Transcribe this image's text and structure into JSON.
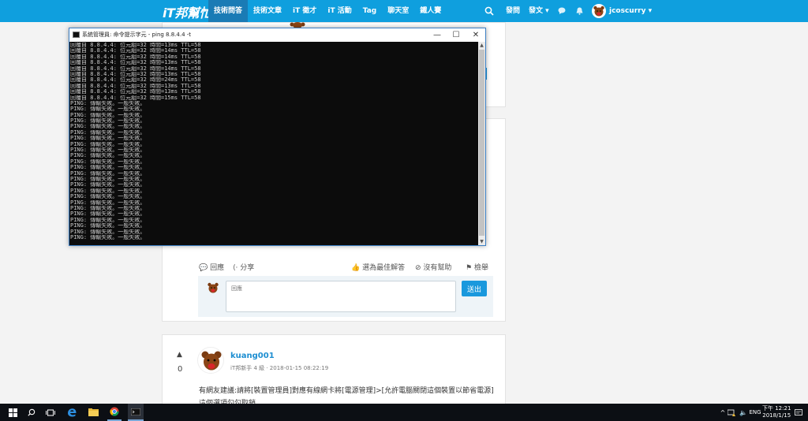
{
  "colors": {
    "brand": "#0f9fde",
    "nav_active": "#1a7bb5",
    "link": "#1d8ed1",
    "console_bg": "#0c0c0c",
    "taskbar": "#0c0f14"
  },
  "header": {
    "logo": "iT邦幫忙",
    "nav": [
      {
        "label": "技術問答",
        "active": true
      },
      {
        "label": "技術文章",
        "active": false
      },
      {
        "label": "iT 徵才",
        "active": false
      },
      {
        "label": "iT 活動",
        "active": false
      },
      {
        "label": "Tag",
        "active": false
      },
      {
        "label": "聊天室",
        "active": false
      },
      {
        "label": "鐵人賽",
        "active": false
      }
    ],
    "ask": "發問",
    "post": "發文",
    "username": "jcoscurry",
    "icons": [
      "search-icon",
      "chat-icon",
      "bell-icon",
      "caret-down-icon"
    ]
  },
  "console": {
    "title": "系統管理員: 命令提示字元 - ping  8.8.4.4 -t",
    "minimize": "—",
    "maximize": "☐",
    "close": "✕",
    "lines": [
      "回覆自 8.8.4.4: 位元組=32 時間=13ms TTL=58",
      "回覆自 8.8.4.4: 位元組=32 時間=14ms TTL=58",
      "回覆自 8.8.4.4: 位元組=32 時間=14ms TTL=58",
      "回覆自 8.8.4.4: 位元組=32 時間=13ms TTL=58",
      "回覆自 8.8.4.4: 位元組=32 時間=14ms TTL=58",
      "回覆自 8.8.4.4: 位元組=32 時間=13ms TTL=58",
      "回覆自 8.8.4.4: 位元組=32 時間=24ms TTL=58",
      "回覆自 8.8.4.4: 位元組=32 時間=13ms TTL=58",
      "回覆自 8.8.4.4: 位元組=32 時間=13ms TTL=58",
      "回覆自 8.8.4.4: 位元組=32 時間=15ms TTL=58",
      "PING: 傳輸失敗。一般失敗。",
      "PING: 傳輸失敗。一般失敗。",
      "PING: 傳輸失敗。一般失敗。",
      "PING: 傳輸失敗。一般失敗。",
      "PING: 傳輸失敗。一般失敗。",
      "PING: 傳輸失敗。一般失敗。",
      "PING: 傳輸失敗。一般失敗。",
      "PING: 傳輸失敗。一般失敗。",
      "PING: 傳輸失敗。一般失敗。",
      "PING: 傳輸失敗。一般失敗。",
      "PING: 傳輸失敗。一般失敗。",
      "PING: 傳輸失敗。一般失敗。",
      "PING: 傳輸失敗。一般失敗。",
      "PING: 傳輸失敗。一般失敗。",
      "PING: 傳輸失敗。一般失敗。",
      "PING: 傳輸失敗。一般失敗。",
      "PING: 傳輸失敗。一般失敗。",
      "PING: 傳輸失敗。一般失敗。",
      "PING: 傳輸失敗。一般失敗。",
      "PING: 傳輸失敗。一般失敗。",
      "PING: 傳輸失敗。一般失敗。",
      "PING: 傳輸失敗。一般失敗。",
      "PING: 傳輸失敗。一般失敗。",
      "PING: 傳輸失敗。一般失敗。"
    ]
  },
  "actions": {
    "reply": "回應",
    "share": "分享",
    "best_answer": "選為最佳解答",
    "not_helpful": "沒有幫助",
    "report": "檢舉"
  },
  "reply_form": {
    "placeholder": "回應",
    "submit": "送出"
  },
  "answer": {
    "votes": "0",
    "author": "kuang001",
    "meta": "iT邦新手 4 級 · 2018-01-15 08:22:19",
    "text": "有網友建議:請將[裝置管理員]對應有線網卡將[電源管理]>[允許電腦關閉這個裝置以節省電源]這個選項勾勾取銷."
  },
  "taskbar": {
    "lang": "ENG",
    "time": "下午 12:21",
    "date": "2018/1/15"
  }
}
